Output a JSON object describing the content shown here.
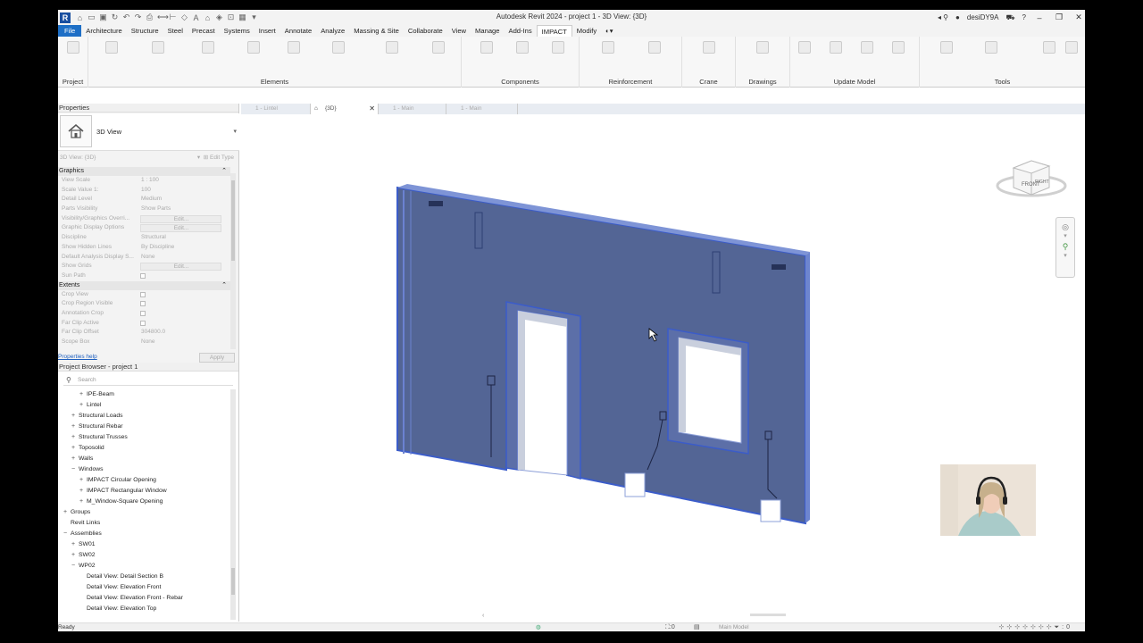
{
  "app": {
    "title": "Autodesk Revit 2024 - project 1 - 3D View: {3D}",
    "logo_letter": "R",
    "user": "desiDY9A"
  },
  "ribbon_tabs": [
    {
      "label": "File"
    },
    {
      "label": "Architecture"
    },
    {
      "label": "Structure"
    },
    {
      "label": "Steel"
    },
    {
      "label": "Precast"
    },
    {
      "label": "Systems"
    },
    {
      "label": "Insert"
    },
    {
      "label": "Annotate"
    },
    {
      "label": "Analyze"
    },
    {
      "label": "Massing & Site"
    },
    {
      "label": "Collaborate"
    },
    {
      "label": "View"
    },
    {
      "label": "Manage"
    },
    {
      "label": "Add-Ins"
    },
    {
      "label": "IMPACT"
    },
    {
      "label": "Modify"
    }
  ],
  "ribbon_groups": {
    "project": "Project",
    "elements": "Elements",
    "components": "Components",
    "reinforcement": "Reinforcement",
    "crane": "Crane",
    "drawings": "Drawings",
    "update_model": "Update Model",
    "tools": "Tools"
  },
  "properties": {
    "title": "Properties",
    "type_name": "3D View",
    "instance_selector": "3D View: {3D}",
    "edit_type": "Edit Type",
    "sections": {
      "graphics": "Graphics",
      "extents": "Extents"
    },
    "graphics_rows": [
      {
        "name": "View Scale",
        "value": "1 : 100"
      },
      {
        "name": "Scale Value    1:",
        "value": "100"
      },
      {
        "name": "Detail Level",
        "value": "Medium"
      },
      {
        "name": "Parts Visibility",
        "value": "Show Parts"
      },
      {
        "name": "Visibility/Graphics Overri...",
        "value": "Edit..."
      },
      {
        "name": "Graphic Display Options",
        "value": "Edit..."
      },
      {
        "name": "Discipline",
        "value": "Structural"
      },
      {
        "name": "Show Hidden Lines",
        "value": "By Discipline"
      },
      {
        "name": "Default Analysis Display S...",
        "value": "None"
      },
      {
        "name": "Show Grids",
        "value": "Edit..."
      },
      {
        "name": "Sun Path",
        "value": ""
      }
    ],
    "extents_rows": [
      {
        "name": "Crop View",
        "value": ""
      },
      {
        "name": "Crop Region Visible",
        "value": ""
      },
      {
        "name": "Annotation Crop",
        "value": ""
      },
      {
        "name": "Far Clip Active",
        "value": ""
      },
      {
        "name": "Far Clip Offset",
        "value": "304800.0"
      },
      {
        "name": "Scope Box",
        "value": "None"
      }
    ],
    "help_link": "Properties help",
    "apply": "Apply"
  },
  "browser": {
    "title": "Project Browser - project 1",
    "search_placeholder": "Search",
    "nodes": [
      {
        "label": "IPE-Beam",
        "toggle": "+",
        "indent": 2
      },
      {
        "label": "Lintel",
        "toggle": "+",
        "indent": 2
      },
      {
        "label": "Structural Loads",
        "toggle": "+",
        "indent": 1
      },
      {
        "label": "Structural Rebar",
        "toggle": "+",
        "indent": 1
      },
      {
        "label": "Structural Trusses",
        "toggle": "+",
        "indent": 1
      },
      {
        "label": "Toposolid",
        "toggle": "+",
        "indent": 1
      },
      {
        "label": "Walls",
        "toggle": "+",
        "indent": 1
      },
      {
        "label": "Windows",
        "toggle": "−",
        "indent": 1
      },
      {
        "label": "IMPACT Circular Opening",
        "toggle": "+",
        "indent": 2
      },
      {
        "label": "IMPACT Rectangular Window",
        "toggle": "+",
        "indent": 2
      },
      {
        "label": "M_Window-Square Opening",
        "toggle": "+",
        "indent": 2
      },
      {
        "label": "Groups",
        "toggle": "+",
        "indent": 0
      },
      {
        "label": "Revit Links",
        "toggle": "",
        "indent": 0
      },
      {
        "label": "Assemblies",
        "toggle": "−",
        "indent": 0
      },
      {
        "label": "SW01",
        "toggle": "+",
        "indent": 1
      },
      {
        "label": "SW02",
        "toggle": "+",
        "indent": 1
      },
      {
        "label": "WP02",
        "toggle": "−",
        "indent": 1
      },
      {
        "label": "Detail View: Detail Section B",
        "toggle": "",
        "indent": 2
      },
      {
        "label": "Detail View: Elevation Front",
        "toggle": "",
        "indent": 2
      },
      {
        "label": "Detail View: Elevation Front - Rebar",
        "toggle": "",
        "indent": 2
      },
      {
        "label": "Detail View: Elevation Top",
        "toggle": "",
        "indent": 2
      }
    ]
  },
  "view_tabs": [
    {
      "label": "1 - Lintel",
      "active": false
    },
    {
      "label": "{3D}",
      "active": true
    },
    {
      "label": "1 - Main",
      "active": false
    },
    {
      "label": "1 - Main",
      "active": false
    }
  ],
  "viewcube": {
    "front": "FRONT",
    "right": "RIGHT"
  },
  "status": {
    "text": "Ready",
    "workset": ":0",
    "model": "Main Model"
  },
  "colors": {
    "file_tab": "#1e6fc6",
    "wall_fill": "#4a5d8f",
    "wall_edge": "#3b5cc9"
  }
}
